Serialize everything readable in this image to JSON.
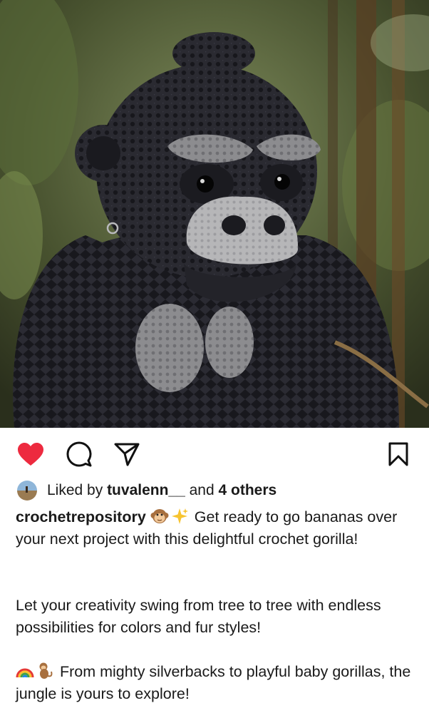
{
  "post": {
    "image_alt": "Crochet gorilla amigurumi in a jungle setting",
    "liked_by_prefix": "Liked by",
    "liked_by_user": "tuvalenn__",
    "liked_by_connector": "and",
    "liked_by_others": "4 others",
    "username": "crochetrepository",
    "caption_line1": "Get ready to go bananas over your next project with this delightful crochet gorilla!",
    "caption_line2": "Let your creativity swing from tree to tree with endless possibilities for colors and fur styles!",
    "caption_line3": "From mighty silverbacks to playful baby gorillas, the jungle is yours to explore!"
  },
  "icons": {
    "like": "heart-icon",
    "comment": "comment-icon",
    "share": "send-icon",
    "save": "bookmark-icon",
    "emoji1": "monkey-face-emoji",
    "emoji2": "sparkles-emoji",
    "emoji3": "rainbow-emoji",
    "emoji4": "monkey-emoji"
  },
  "colors": {
    "like_active": "#ed2a3f",
    "text": "#1a1a1a",
    "background": "#ffffff"
  }
}
